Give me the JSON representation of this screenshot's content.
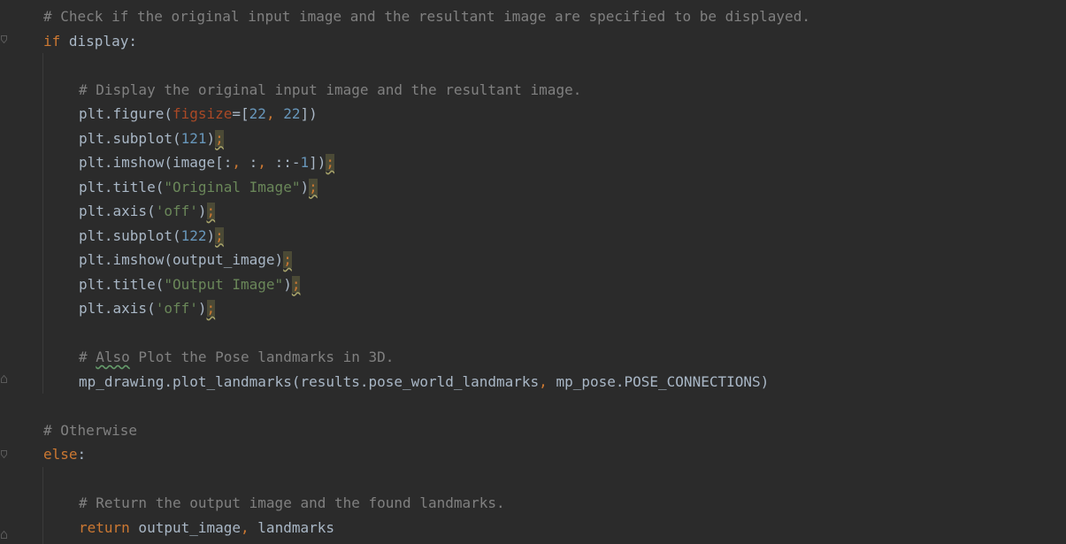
{
  "editor": {
    "language": "python",
    "colors": {
      "background": "#2b2b2b",
      "default": "#a9b7c6",
      "comment": "#808080",
      "keyword": "#cc7832",
      "number": "#6897bb",
      "string": "#6a8759",
      "param": "#aa4926",
      "warning_bg": "#4b4a36"
    },
    "lines": [
      {
        "indent": 1,
        "tokens": [
          {
            "t": "# Check if the original input image and the resultant image are specified to be displayed.",
            "k": "comment"
          }
        ]
      },
      {
        "indent": 1,
        "tokens": [
          {
            "t": "if",
            "k": "kw"
          },
          {
            "t": " display:",
            "k": "plain"
          }
        ]
      },
      {
        "indent": 0,
        "tokens": []
      },
      {
        "indent": 2,
        "tokens": [
          {
            "t": "# Display the original input image and the resultant image.",
            "k": "comment"
          }
        ]
      },
      {
        "indent": 2,
        "tokens": [
          {
            "t": "plt.figure(",
            "k": "plain"
          },
          {
            "t": "figsize",
            "k": "param"
          },
          {
            "t": "=[",
            "k": "plain"
          },
          {
            "t": "22",
            "k": "num"
          },
          {
            "t": ", ",
            "k": "punc"
          },
          {
            "t": "22",
            "k": "num"
          },
          {
            "t": "])",
            "k": "plain"
          }
        ]
      },
      {
        "indent": 2,
        "tokens": [
          {
            "t": "plt.subplot(",
            "k": "plain"
          },
          {
            "t": "121",
            "k": "num"
          },
          {
            "t": ")",
            "k": "plain"
          },
          {
            "t": ";",
            "k": "warn"
          }
        ]
      },
      {
        "indent": 2,
        "tokens": [
          {
            "t": "plt.imshow(image[:",
            "k": "plain"
          },
          {
            "t": ", ",
            "k": "punc"
          },
          {
            "t": ":",
            "k": "plain"
          },
          {
            "t": ", ",
            "k": "punc"
          },
          {
            "t": "::-",
            "k": "plain"
          },
          {
            "t": "1",
            "k": "num"
          },
          {
            "t": "])",
            "k": "plain"
          },
          {
            "t": ";",
            "k": "warn"
          }
        ]
      },
      {
        "indent": 2,
        "tokens": [
          {
            "t": "plt.title(",
            "k": "plain"
          },
          {
            "t": "\"Original Image\"",
            "k": "str"
          },
          {
            "t": ")",
            "k": "plain"
          },
          {
            "t": ";",
            "k": "warn"
          }
        ]
      },
      {
        "indent": 2,
        "tokens": [
          {
            "t": "plt.axis(",
            "k": "plain"
          },
          {
            "t": "'off'",
            "k": "str"
          },
          {
            "t": ")",
            "k": "plain"
          },
          {
            "t": ";",
            "k": "warn"
          }
        ]
      },
      {
        "indent": 2,
        "tokens": [
          {
            "t": "plt.subplot(",
            "k": "plain"
          },
          {
            "t": "122",
            "k": "num"
          },
          {
            "t": ")",
            "k": "plain"
          },
          {
            "t": ";",
            "k": "warn"
          }
        ]
      },
      {
        "indent": 2,
        "tokens": [
          {
            "t": "plt.imshow(output_image)",
            "k": "plain"
          },
          {
            "t": ";",
            "k": "warn"
          }
        ]
      },
      {
        "indent": 2,
        "tokens": [
          {
            "t": "plt.title(",
            "k": "plain"
          },
          {
            "t": "\"Output Image\"",
            "k": "str"
          },
          {
            "t": ")",
            "k": "plain"
          },
          {
            "t": ";",
            "k": "warn"
          }
        ]
      },
      {
        "indent": 2,
        "tokens": [
          {
            "t": "plt.axis(",
            "k": "plain"
          },
          {
            "t": "'off'",
            "k": "str"
          },
          {
            "t": ")",
            "k": "plain"
          },
          {
            "t": ";",
            "k": "warn"
          }
        ]
      },
      {
        "indent": 0,
        "tokens": []
      },
      {
        "indent": 2,
        "tokens": [
          {
            "t": "# ",
            "k": "comment"
          },
          {
            "t": "Also",
            "k": "comment-typo"
          },
          {
            "t": " Plot the Pose landmarks in 3D.",
            "k": "comment"
          }
        ]
      },
      {
        "indent": 2,
        "tokens": [
          {
            "t": "mp_drawing.plot_landmarks(results.pose_world_landmarks",
            "k": "plain"
          },
          {
            "t": ", ",
            "k": "punc"
          },
          {
            "t": "mp_pose.POSE_CONNECTIONS)",
            "k": "plain"
          }
        ]
      },
      {
        "indent": 0,
        "tokens": []
      },
      {
        "indent": 1,
        "tokens": [
          {
            "t": "# Otherwise",
            "k": "comment"
          }
        ]
      },
      {
        "indent": 1,
        "tokens": [
          {
            "t": "else",
            "k": "kw"
          },
          {
            "t": ":",
            "k": "plain"
          }
        ]
      },
      {
        "indent": 0,
        "tokens": []
      },
      {
        "indent": 2,
        "tokens": [
          {
            "t": "# Return the output image and the found landmarks.",
            "k": "comment"
          }
        ]
      },
      {
        "indent": 2,
        "tokens": [
          {
            "t": "return",
            "k": "kw"
          },
          {
            "t": " output_image",
            "k": "plain"
          },
          {
            "t": ", ",
            "k": "punc"
          },
          {
            "t": "landmarks",
            "k": "plain"
          }
        ]
      }
    ]
  }
}
